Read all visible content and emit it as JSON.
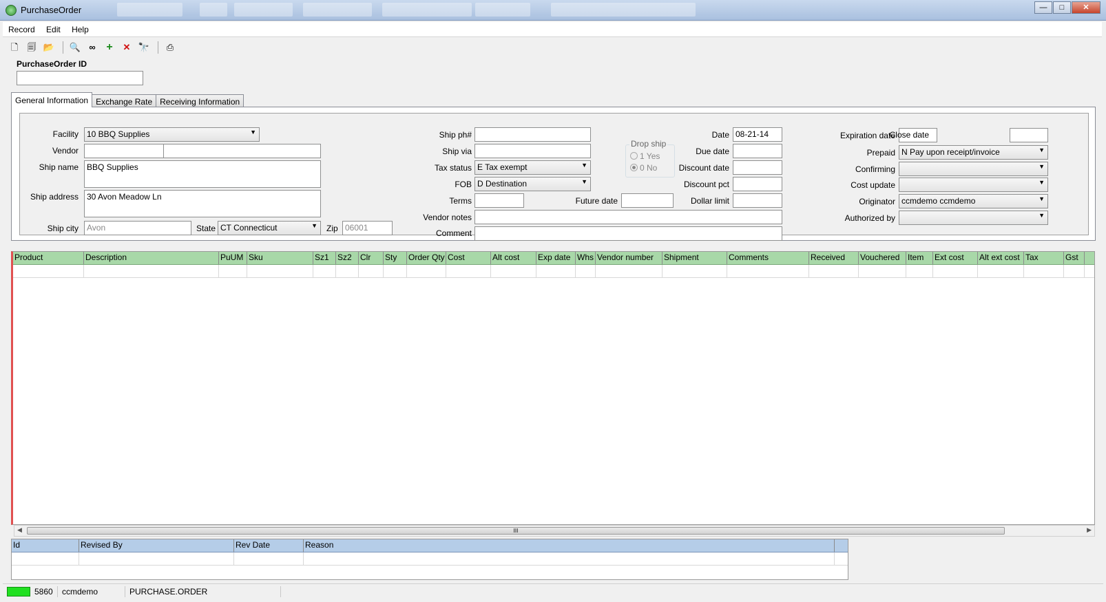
{
  "window": {
    "title": "PurchaseOrder",
    "min": "—",
    "max": "□",
    "close": "✕"
  },
  "menu": [
    "Record",
    "Edit",
    "Help"
  ],
  "toolbar": {
    "icons": [
      {
        "name": "new-record-icon",
        "glyph": "🗋"
      },
      {
        "name": "copy-record-icon",
        "glyph": "🗐"
      },
      {
        "name": "open-folder-icon",
        "glyph": "📂"
      },
      {
        "name": "zoom-icon",
        "glyph": "🔍"
      },
      {
        "name": "view-icon",
        "glyph": "∞"
      },
      {
        "name": "add-icon",
        "glyph": "+"
      },
      {
        "name": "delete-icon",
        "glyph": "✕"
      },
      {
        "name": "binoculars-icon",
        "glyph": "🔭"
      },
      {
        "name": "print-icon",
        "glyph": "⎙"
      }
    ]
  },
  "header": {
    "id_label": "PurchaseOrder ID",
    "id_value": ""
  },
  "tabs": [
    "General Information",
    "Exchange Rate",
    "Receiving Information"
  ],
  "form": {
    "facility": {
      "label": "Facility",
      "value": "10 BBQ Supplies"
    },
    "vendor": {
      "label": "Vendor",
      "code": "",
      "name": ""
    },
    "ship_name": {
      "label": "Ship name",
      "value": "BBQ Supplies"
    },
    "ship_address": {
      "label": "Ship address",
      "value": "30 Avon Meadow Ln"
    },
    "ship_city": {
      "label": "Ship city",
      "value": "Avon"
    },
    "state": {
      "label": "State",
      "value": "CT Connecticut"
    },
    "zip": {
      "label": "Zip",
      "value": "06001"
    },
    "ship_ph": {
      "label": "Ship ph#",
      "value": ""
    },
    "ship_via": {
      "label": "Ship via",
      "value": ""
    },
    "tax_status": {
      "label": "Tax status",
      "value": "E Tax exempt"
    },
    "fob": {
      "label": "FOB",
      "value": "D Destination"
    },
    "terms": {
      "label": "Terms",
      "value": ""
    },
    "future_date": {
      "label": "Future date",
      "value": ""
    },
    "vendor_notes": {
      "label": "Vendor notes",
      "value": ""
    },
    "comment": {
      "label": "Comment",
      "value": ""
    },
    "drop_ship": {
      "label": "Drop ship",
      "options": [
        "1  Yes",
        "0  No"
      ],
      "selected": "0  No"
    },
    "date": {
      "label": "Date",
      "value": "08-21-14"
    },
    "due_date": {
      "label": "Due date",
      "value": ""
    },
    "discount_date": {
      "label": "Discount date",
      "value": ""
    },
    "discount_pct": {
      "label": "Discount pct",
      "value": ""
    },
    "dollar_limit": {
      "label": "Dollar limit",
      "value": ""
    },
    "expiration_date": {
      "label": "Expiration date",
      "value": ""
    },
    "close_date": {
      "label": "Close date",
      "value": ""
    },
    "prepaid": {
      "label": "Prepaid",
      "value": "N Pay upon receipt/invoice"
    },
    "confirming": {
      "label": "Confirming",
      "value": ""
    },
    "cost_update": {
      "label": "Cost update",
      "value": ""
    },
    "originator": {
      "label": "Originator",
      "value": "ccmdemo ccmdemo"
    },
    "authorized_by": {
      "label": "Authorized by",
      "value": ""
    }
  },
  "lines_grid": {
    "columns": [
      "Product",
      "Description",
      "PuUM",
      "Sku",
      "Sz1",
      "Sz2",
      "Clr",
      "Sty",
      "Order Qty",
      "Cost",
      "Alt cost",
      "Exp date",
      "Whs",
      "Vendor number",
      "Shipment",
      "Comments",
      "Received",
      "Vouchered",
      "Item",
      "Ext cost",
      "Alt ext cost",
      "Tax",
      "Gst"
    ],
    "rows": [
      [
        "",
        "",
        "",
        "",
        "",
        "",
        "",
        "",
        "",
        "",
        "",
        "",
        "",
        "",
        "",
        "",
        "",
        "",
        "",
        "",
        "",
        "",
        ""
      ]
    ]
  },
  "scrollbar": {
    "grip": "III"
  },
  "revisions_grid": {
    "columns": [
      "Id",
      "Revised By",
      "Rev Date",
      "Reason"
    ],
    "rows": [
      [
        "",
        "",
        "",
        ""
      ]
    ]
  },
  "status": {
    "number": "5860",
    "user": "ccmdemo",
    "table": "PURCHASE.ORDER"
  }
}
